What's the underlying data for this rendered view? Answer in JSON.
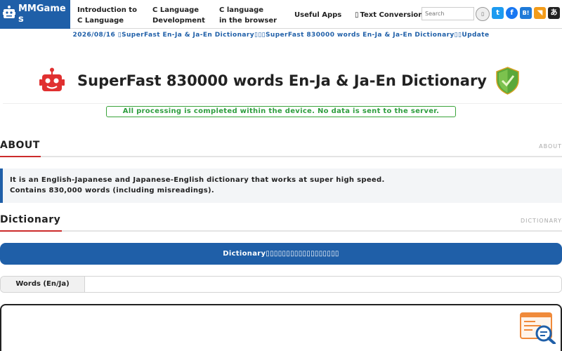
{
  "header": {
    "logo_text": "MMGames",
    "nav": [
      {
        "label": "Introduction to\nC Language"
      },
      {
        "label": "C Language\nDevelopment"
      },
      {
        "label": "C language\nin the browser"
      },
      {
        "label": "Useful Apps"
      },
      {
        "label": "▯ Text Conversion"
      }
    ],
    "search_placeholder": "Search",
    "search_button_icon": "▯",
    "social": [
      {
        "icon": "twitter-icon",
        "glyph": "t",
        "color": "#1d9bf0"
      },
      {
        "icon": "facebook-icon",
        "glyph": "f",
        "color": "#1877f2"
      },
      {
        "icon": "hatena-bookmark-icon",
        "glyph": "B!",
        "color": "#1f7ad8"
      },
      {
        "icon": "rss-icon",
        "glyph": "◥",
        "color": "#f39c1a"
      },
      {
        "icon": "japanese-a-icon",
        "glyph": "あ",
        "color": "#222222"
      }
    ]
  },
  "news": "2026/08/16 ▯SuperFast En-Ja & Ja-En Dictionary▯▯▯SuperFast 830000 words En-Ja & Ja-En Dictionary▯▯Update",
  "title": "SuperFast 830000 words En-Ja & Ja-En Dictionary",
  "notice": "All processing is completed within the device. No data is sent to the server.",
  "about": {
    "heading": "ABOUT",
    "label": "ABOUT",
    "lines": [
      "It is an English-Japanese and Japanese-English dictionary that works at super high speed.",
      "Contains 830,000 words (including misreadings)."
    ]
  },
  "dictionary": {
    "heading": "Dictionary",
    "label": "DICTIONARY",
    "button_label": "Dictionary▯▯▯▯▯▯▯▯▯▯▯▯▯▯▯▯▯▯",
    "words_label": "Words (En/Ja)",
    "words_value": ""
  },
  "colors": {
    "brand_blue": "#1f5fa8",
    "accent_red": "#cc2b2b",
    "notice_green": "#2f9e3f"
  }
}
